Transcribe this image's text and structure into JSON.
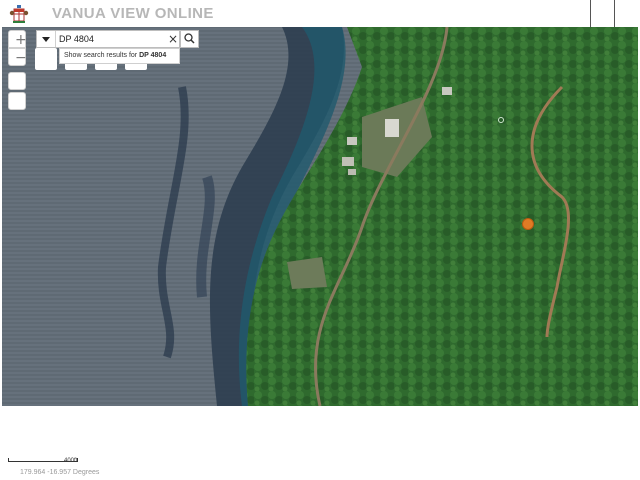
{
  "header": {
    "title": "VANUA VIEW ONLINE",
    "logo_icon": "coat-of-arms-icon"
  },
  "map": {
    "zoom_in_label": "+",
    "zoom_out_label": "−",
    "search": {
      "value": "DP 4804",
      "clear_label": "×",
      "toggle_icon": "caret-down-icon",
      "go_icon": "search-icon"
    },
    "suggestion": {
      "prefix": "Show search results for ",
      "term": "DP 4804"
    },
    "marker_color": "#e07b25"
  },
  "footer": {
    "scale_label": "400ft",
    "coordinates": "179.964 -16.957 Degrees"
  }
}
